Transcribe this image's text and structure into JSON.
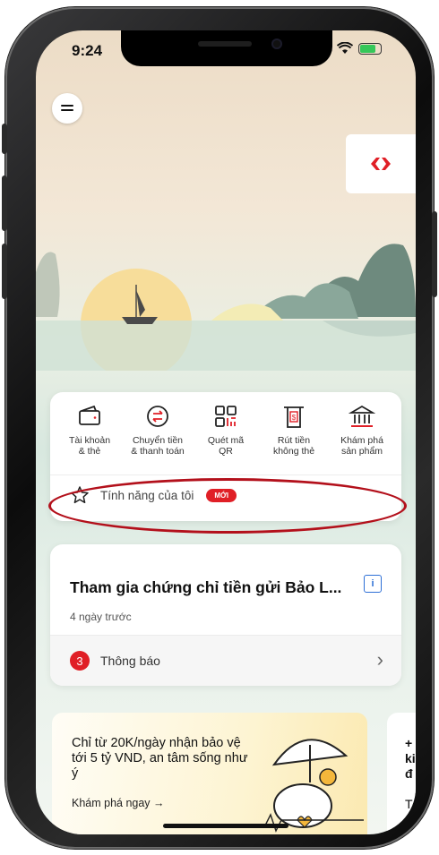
{
  "status_bar": {
    "time": "9:24"
  },
  "quick_actions": [
    {
      "label1": "Tài khoản",
      "label2": "& thẻ",
      "icon": "wallet-icon"
    },
    {
      "label1": "Chuyển tiền",
      "label2": "& thanh toán",
      "icon": "transfer-icon"
    },
    {
      "label1": "Quét mã",
      "label2": "QR",
      "icon": "qr-icon"
    },
    {
      "label1": "Rút tiền",
      "label2": "không thẻ",
      "icon": "atm-icon"
    },
    {
      "label1": "Khám phá",
      "label2": "sản phẩm",
      "icon": "bank-icon"
    }
  ],
  "my_features": {
    "label": "Tính năng của tôi",
    "badge": "MỚI"
  },
  "notification": {
    "title": "Tham gia chứng chỉ tiền gửi Bảo L...",
    "time": "4 ngày trước",
    "count": "3",
    "footer_label": "Thông báo"
  },
  "promo": {
    "text": "Chỉ từ 20K/ngày nhận bảo vệ tới 5 tỷ VND, an tâm sống như ý",
    "link": "Khám phá ngay →"
  },
  "promo_next": {
    "line1": "+",
    "line2": "ki",
    "line3": "đ",
    "line4": "T"
  },
  "colors": {
    "brand_red": "#e01f26",
    "info_blue": "#2d6fd6"
  }
}
